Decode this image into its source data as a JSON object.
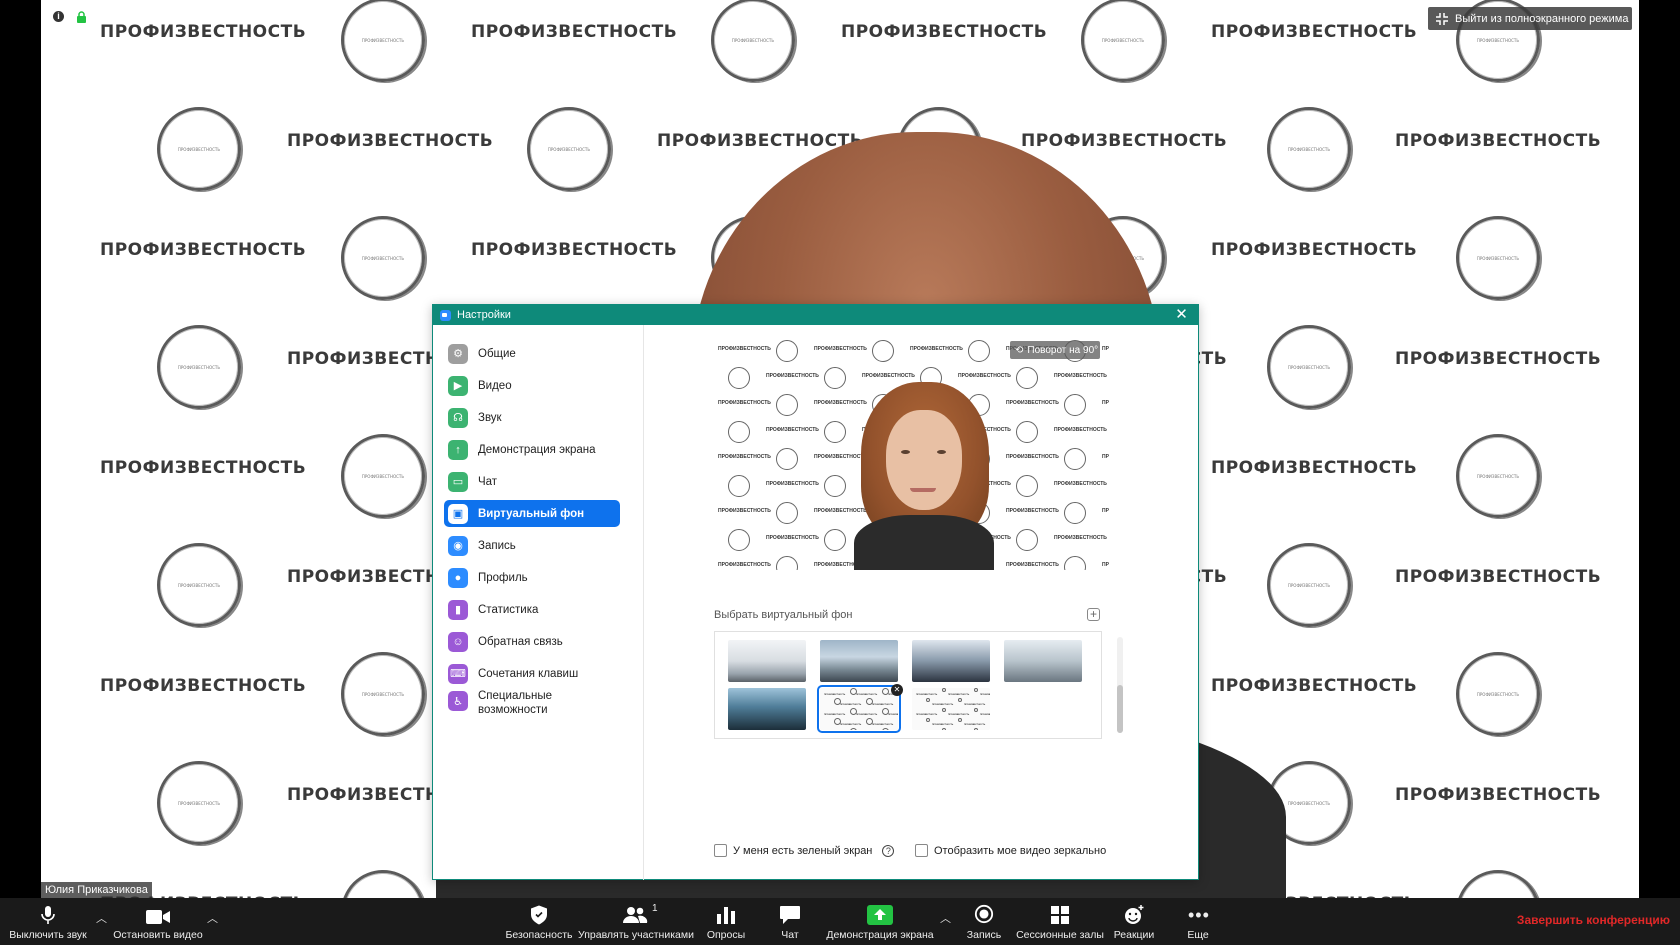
{
  "backdrop": {
    "brand": "ПРОФИЗВЕСТНОСТЬ"
  },
  "top": {
    "exit_fullscreen": "Выйти из полноэкранного режима"
  },
  "participant": {
    "name": "Юлия Приказчикова"
  },
  "settings": {
    "title": "Настройки",
    "nav": [
      {
        "label": "Общие",
        "icon": "gear-icon",
        "color": "#9e9e9e"
      },
      {
        "label": "Видео",
        "icon": "video-camera-icon",
        "color": "#3cb371"
      },
      {
        "label": "Звук",
        "icon": "headphones-icon",
        "color": "#3cb371"
      },
      {
        "label": "Демонстрация экрана",
        "icon": "share-screen-icon",
        "color": "#3cb371"
      },
      {
        "label": "Чат",
        "icon": "chat-bubble-icon",
        "color": "#3cb371"
      },
      {
        "label": "Виртуальный фон",
        "icon": "portrait-icon",
        "color": "#0e72ed"
      },
      {
        "label": "Запись",
        "icon": "record-icon",
        "color": "#2d8cff"
      },
      {
        "label": "Профиль",
        "icon": "person-icon",
        "color": "#2d8cff"
      },
      {
        "label": "Статистика",
        "icon": "bar-chart-icon",
        "color": "#9b59d6"
      },
      {
        "label": "Обратная связь",
        "icon": "smiley-icon",
        "color": "#9b59d6"
      },
      {
        "label": "Сочетания клавиш",
        "icon": "keyboard-icon",
        "color": "#9b59d6"
      },
      {
        "label": "Специальные",
        "label2": "возможности",
        "icon": "accessibility-icon",
        "color": "#9b59d6"
      }
    ],
    "rotate": "Поворот на 90°",
    "choose_bg": "Выбрать виртуальный фон",
    "green_screen": "У меня есть зеленый экран",
    "mirror": "Отобразить мое видео зеркально"
  },
  "toolbar": {
    "mute": "Выключить звук",
    "stop_video": "Остановить видео",
    "security": "Безопасность",
    "participants": "Управлять участниками",
    "participants_count": "1",
    "polls": "Опросы",
    "chat": "Чат",
    "share": "Демонстрация экрана",
    "record": "Запись",
    "breakout": "Сессионные залы",
    "reactions": "Реакции",
    "more": "Еще",
    "end": "Завершить конференцию"
  },
  "colors": {
    "accent": "#0e72ed",
    "title_bar": "#0e8a7a",
    "end": "#e02828",
    "share_green": "#23c343"
  }
}
